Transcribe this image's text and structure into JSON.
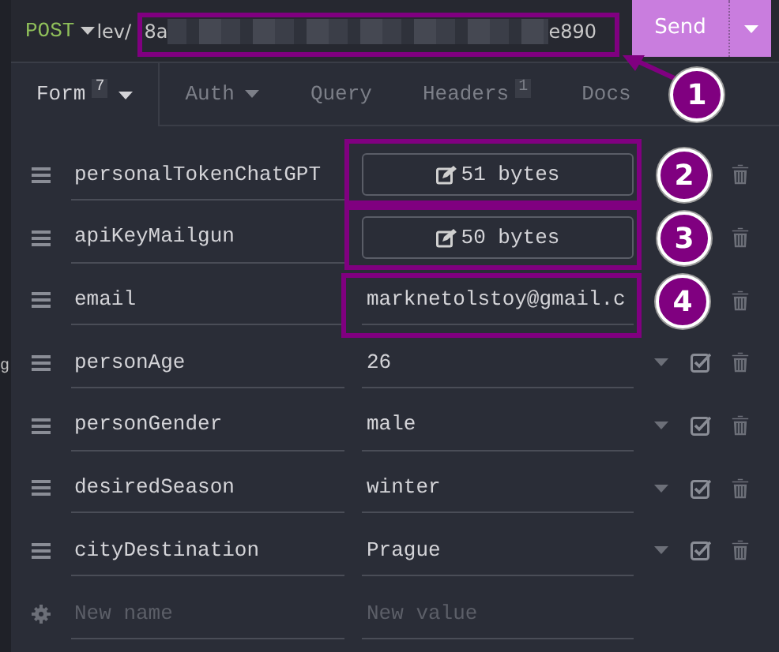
{
  "sidebar": {
    "text": "g"
  },
  "request": {
    "method": "POST",
    "url_start": "lev/",
    "url_middle": "8a",
    "url_end": "e890",
    "send": "Send"
  },
  "tabs": [
    {
      "label": "Form",
      "badge": "7",
      "selected": true,
      "dropdown": true
    },
    {
      "label": "Auth",
      "selected": false,
      "dropdown": true
    },
    {
      "label": "Query",
      "selected": false,
      "dropdown": false
    },
    {
      "label": "Headers",
      "badge": "1",
      "selected": false,
      "dropdown": false
    },
    {
      "label": "Docs",
      "selected": false,
      "dropdown": false
    }
  ],
  "params": [
    {
      "name": "personalTokenChatGPT",
      "kind": "multiline",
      "value": "51 bytes"
    },
    {
      "name": "apiKeyMailgun",
      "kind": "multiline",
      "value": "50 bytes"
    },
    {
      "name": "email",
      "kind": "text",
      "value": "marknetolstoy@gmail.c"
    },
    {
      "name": "personAge",
      "kind": "text",
      "value": "26",
      "enabled": true
    },
    {
      "name": "personGender",
      "kind": "text",
      "value": "male",
      "enabled": true
    },
    {
      "name": "desiredSeason",
      "kind": "text",
      "value": "winter",
      "enabled": true
    },
    {
      "name": "cityDestination",
      "kind": "text",
      "value": "Prague",
      "enabled": true
    }
  ],
  "new_param": {
    "name_placeholder": "New name",
    "value_placeholder": "New value"
  },
  "annotations": [
    {
      "label": "1"
    },
    {
      "label": "2"
    },
    {
      "label": "3"
    },
    {
      "label": "4"
    }
  ]
}
